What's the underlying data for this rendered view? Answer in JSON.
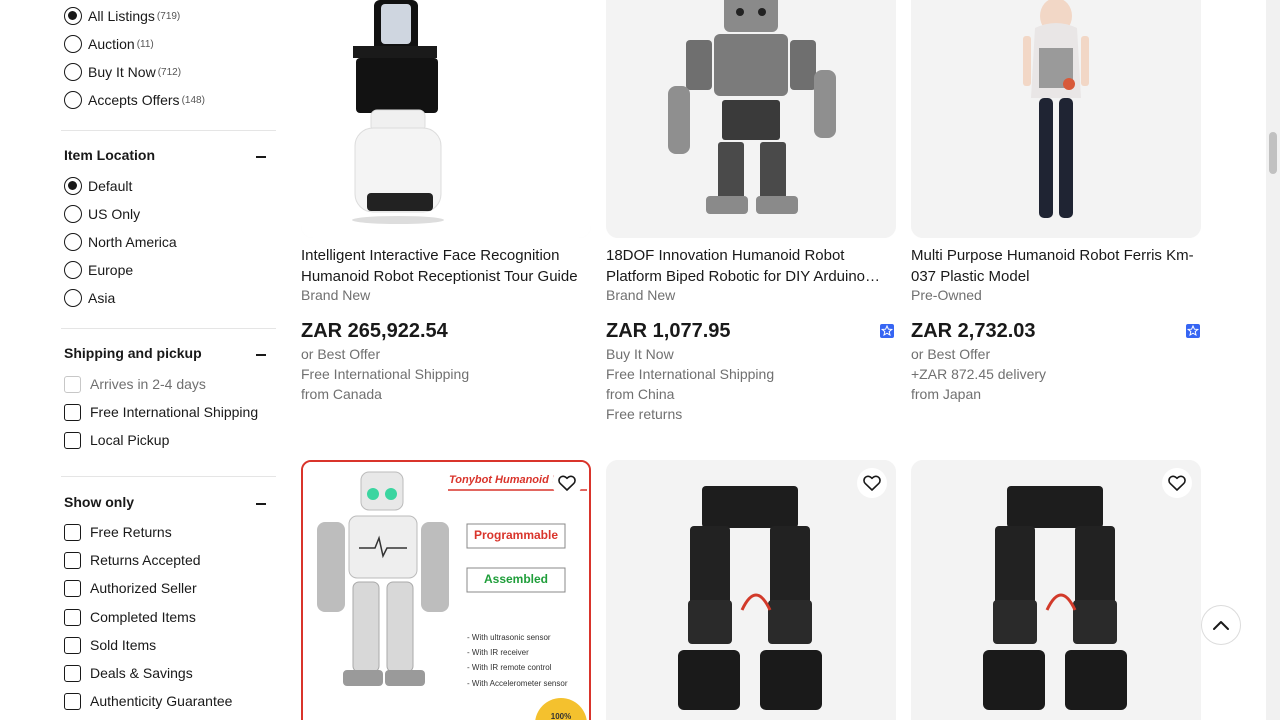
{
  "filters": {
    "buying_format": {
      "options": [
        {
          "label": "All Listings",
          "count": "(719)",
          "selected": true
        },
        {
          "label": "Auction",
          "count": "(11)",
          "selected": false
        },
        {
          "label": "Buy It Now",
          "count": "(712)",
          "selected": false
        },
        {
          "label": "Accepts Offers",
          "count": "(148)",
          "selected": false
        }
      ]
    },
    "item_location": {
      "title": "Item Location",
      "options": [
        {
          "label": "Default",
          "selected": true
        },
        {
          "label": "US Only",
          "selected": false
        },
        {
          "label": "North America",
          "selected": false
        },
        {
          "label": "Europe",
          "selected": false
        },
        {
          "label": "Asia",
          "selected": false
        }
      ]
    },
    "shipping": {
      "title": "Shipping and pickup",
      "options": [
        {
          "label": "Arrives in 2-4 days",
          "disabled": true
        },
        {
          "label": "Free International Shipping",
          "disabled": false
        },
        {
          "label": "Local Pickup",
          "disabled": false
        }
      ]
    },
    "show_only": {
      "title": "Show only",
      "options": [
        {
          "label": "Free Returns"
        },
        {
          "label": "Returns Accepted"
        },
        {
          "label": "Authorized Seller"
        },
        {
          "label": "Completed Items"
        },
        {
          "label": "Sold Items"
        },
        {
          "label": "Deals & Savings"
        },
        {
          "label": "Authenticity Guarantee"
        }
      ]
    }
  },
  "listings": [
    {
      "title": "Intelligent Interactive Face Recognition Humanoid Robot Receptionist Tour Guide",
      "condition": "Brand New",
      "price": "ZAR 265,922.54",
      "lines": [
        "or Best Offer",
        "Free International Shipping",
        "from Canada"
      ]
    },
    {
      "title": "18DOF Innovation Humanoid Robot Platform Biped Robotic for DIY Arduino…",
      "condition": "Brand New",
      "price": "ZAR 1,077.95",
      "lines": [
        "Buy It Now",
        "Free International Shipping",
        "from China",
        "Free returns"
      ]
    },
    {
      "title": "Multi Purpose Humanoid Robot Ferris Km-037 Plastic Model",
      "condition": "Pre-Owned",
      "price": "ZAR 2,732.03",
      "lines": [
        "or Best Offer",
        "+ZAR 872.45 delivery",
        "from Japan"
      ]
    }
  ],
  "promo_image": {
    "title": "Tonybot Humanoid R",
    "tag1": "Programmable",
    "tag2": "Assembled",
    "features": [
      "- With ultrasonic sensor",
      "- With IR receiver",
      "- With IR remote control",
      "- With Accelerometer sensor"
    ],
    "seal": "100%"
  },
  "colors": {
    "accent": "#3665f3",
    "text": "#191919",
    "secondary": "#707070"
  }
}
